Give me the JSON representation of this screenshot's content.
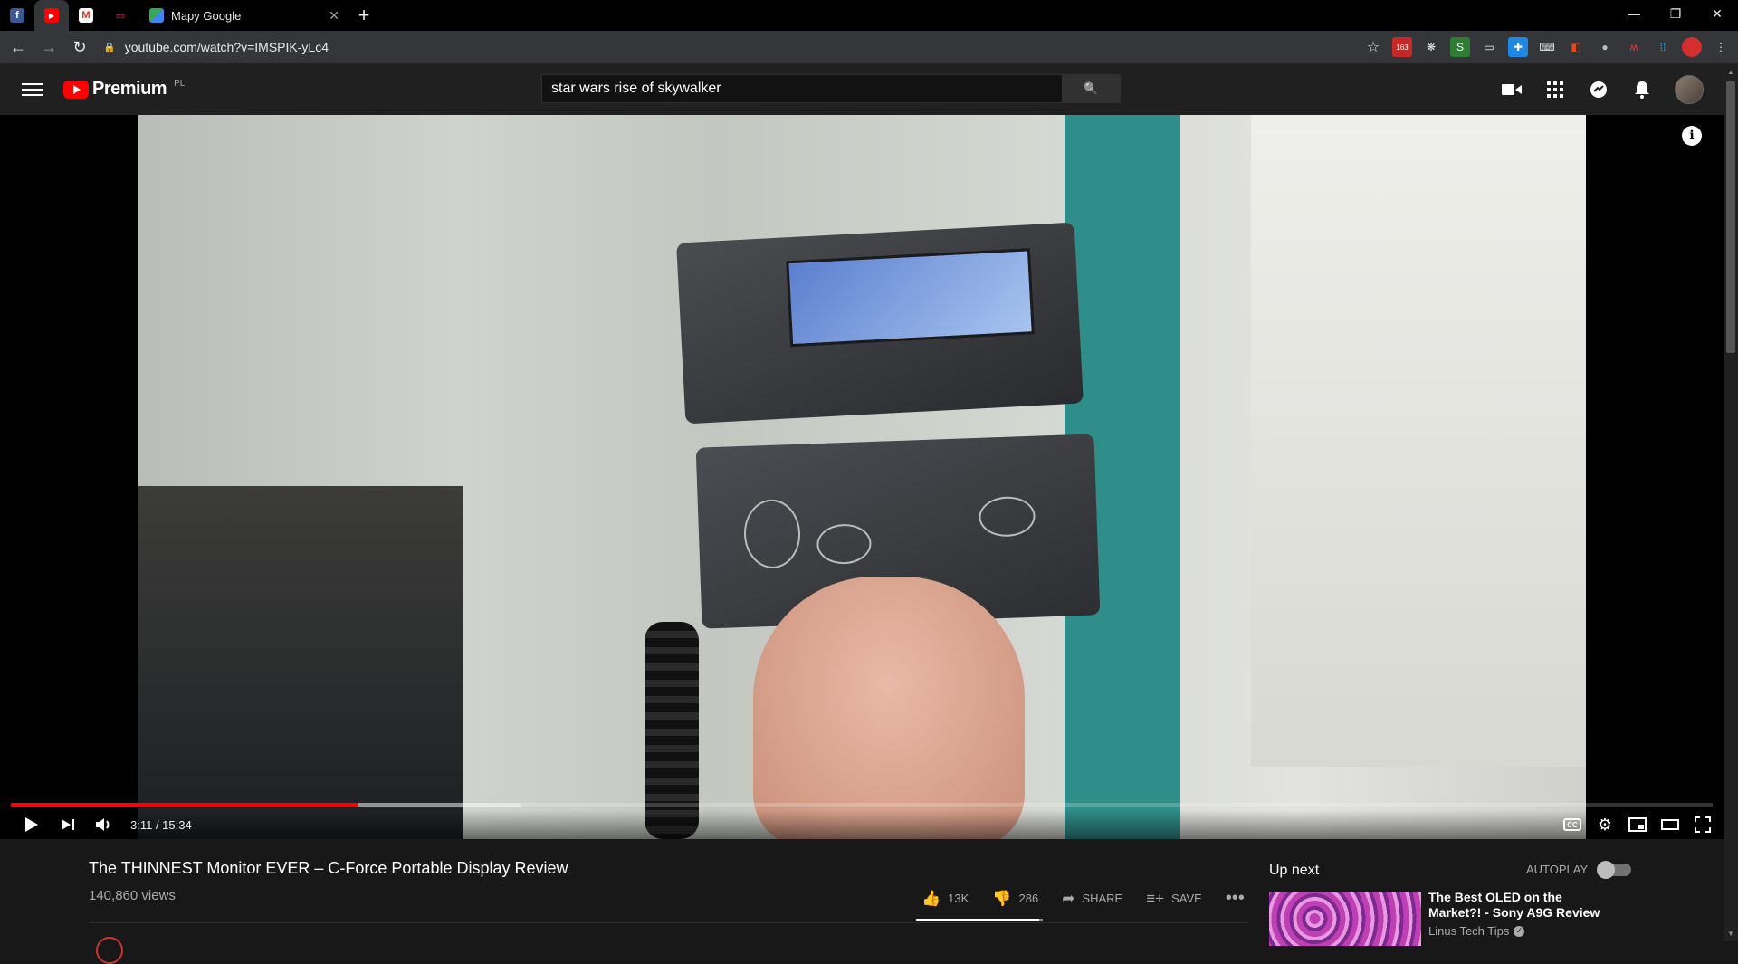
{
  "browser": {
    "tabs": [
      {
        "name": "facebook",
        "glyph": "f",
        "color": "#3b5998"
      },
      {
        "name": "youtube",
        "glyph": "▶",
        "color": "#ff0000"
      },
      {
        "name": "gmail",
        "glyph": "M",
        "color": "#d93025"
      },
      {
        "name": "app",
        "glyph": "▭",
        "color": "#e91e63"
      }
    ],
    "active_tab_title": "Mapy Google",
    "close_glyph": "✕",
    "new_tab_glyph": "+",
    "url": "youtube.com/watch?v=IMSPIK-yLc4",
    "extensions_badge": "163"
  },
  "youtube": {
    "logo_text": "Premium",
    "region": "PL",
    "search_value": "star wars rise of skywalker",
    "search_icon": "🔍",
    "header_icons": {
      "create": "■",
      "apps": "⋮⋮⋮",
      "messages": "●",
      "notifications": "🔔"
    }
  },
  "player": {
    "current_time": "3:11",
    "duration": "15:34",
    "time_display": "3:11 / 15:34",
    "played_fraction": 0.204,
    "buffered_fraction": 0.3,
    "info_glyph": "i",
    "cc_label": "CC"
  },
  "video": {
    "title": "The THINNEST Monitor EVER – C-Force Portable Display Review",
    "views": "140,860 views",
    "likes": "13K",
    "dislikes": "286",
    "share_label": "SHARE",
    "save_label": "SAVE"
  },
  "sidebar": {
    "up_next_label": "Up next",
    "autoplay_label": "AUTOPLAY",
    "autoplay_on": false,
    "next_video": {
      "title": "The Best OLED on the Market?! - Sony A9G Review",
      "channel": "Linus Tech Tips",
      "verified": "✓"
    }
  },
  "colors": {
    "accent": "#ff0000",
    "background": "#181818",
    "header": "#202020"
  }
}
